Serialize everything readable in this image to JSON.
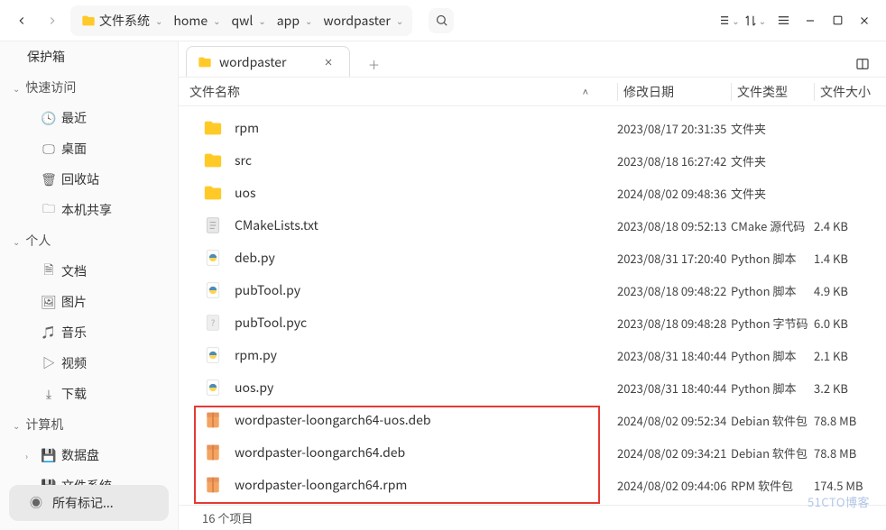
{
  "toolbar": {
    "breadcrumb": [
      {
        "label": "文件系统",
        "hasFolder": true
      },
      {
        "label": "home"
      },
      {
        "label": "qwl"
      },
      {
        "label": "app"
      },
      {
        "label": "wordpaster"
      }
    ]
  },
  "sidebar": {
    "safebox": "保护箱",
    "sections": [
      {
        "title": "快速访问",
        "items": [
          {
            "icon": "clock",
            "label": "最近"
          },
          {
            "icon": "desktop",
            "label": "桌面"
          },
          {
            "icon": "trash",
            "label": "回收站"
          },
          {
            "icon": "share",
            "label": "本机共享"
          }
        ]
      },
      {
        "title": "个人",
        "items": [
          {
            "icon": "doc",
            "label": "文档"
          },
          {
            "icon": "image",
            "label": "图片"
          },
          {
            "icon": "music",
            "label": "音乐"
          },
          {
            "icon": "video",
            "label": "视频"
          },
          {
            "icon": "download",
            "label": "下载"
          }
        ]
      },
      {
        "title": "计算机",
        "items": [
          {
            "icon": "disk",
            "label": "数据盘",
            "expandable": true
          },
          {
            "icon": "disk",
            "label": "文件系统",
            "expandable": true
          }
        ]
      }
    ],
    "footer": "所有标记..."
  },
  "tabs": {
    "current": "wordpaster"
  },
  "columns": {
    "name": "文件名称",
    "date": "修改日期",
    "type": "文件类型",
    "size": "文件大小"
  },
  "files": [
    {
      "icon": "folder",
      "name": "rpm",
      "date": "2023/08/17 20:31:35",
      "type": "文件夹",
      "size": ""
    },
    {
      "icon": "folder",
      "name": "src",
      "date": "2023/08/18 16:27:42",
      "type": "文件夹",
      "size": ""
    },
    {
      "icon": "folder",
      "name": "uos",
      "date": "2024/08/02 09:48:36",
      "type": "文件夹",
      "size": ""
    },
    {
      "icon": "text",
      "name": "CMakeLists.txt",
      "date": "2023/08/18 09:52:13",
      "type": "CMake 源代码",
      "size": "2.4 KB"
    },
    {
      "icon": "python",
      "name": "deb.py",
      "date": "2023/08/31 17:20:40",
      "type": "Python 脚本",
      "size": "1.4 KB"
    },
    {
      "icon": "python",
      "name": "pubTool.py",
      "date": "2023/08/18 09:48:22",
      "type": "Python 脚本",
      "size": "4.9 KB"
    },
    {
      "icon": "unknown",
      "name": "pubTool.pyc",
      "date": "2023/08/18 09:48:28",
      "type": "Python 字节码",
      "size": "6.0 KB"
    },
    {
      "icon": "python",
      "name": "rpm.py",
      "date": "2023/08/31 18:40:44",
      "type": "Python 脚本",
      "size": "2.1 KB"
    },
    {
      "icon": "python",
      "name": "uos.py",
      "date": "2023/08/31 18:40:44",
      "type": "Python 脚本",
      "size": "3.2 KB"
    },
    {
      "icon": "package",
      "name": "wordpaster-loongarch64-uos.deb",
      "date": "2024/08/02 09:52:34",
      "type": "Debian 软件包",
      "size": "78.8 MB"
    },
    {
      "icon": "package",
      "name": "wordpaster-loongarch64.deb",
      "date": "2024/08/02 09:34:21",
      "type": "Debian 软件包",
      "size": "78.8 MB"
    },
    {
      "icon": "package",
      "name": "wordpaster-loongarch64.rpm",
      "date": "2024/08/02 09:44:06",
      "type": "RPM 软件包",
      "size": "174.5 MB"
    }
  ],
  "statusbar": "16 个项目",
  "watermark": "51CTO博客"
}
